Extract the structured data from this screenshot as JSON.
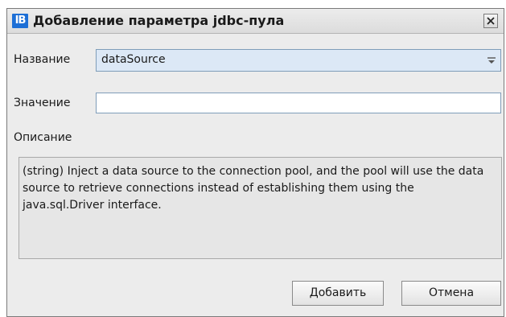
{
  "window": {
    "app_icon": "IB",
    "title": "Добавление параметра jdbc-пула",
    "close_icon": "close-icon"
  },
  "form": {
    "name_label": "Название",
    "name_value": "dataSource",
    "value_label": "Значение",
    "value_input": "",
    "description_label": "Описание",
    "description_text": "(string) Inject a data source to the connection pool, and the pool will use the data source to retrieve connections instead of establishing them using the java.sql.Driver interface."
  },
  "buttons": {
    "add_label": "Добавить",
    "cancel_label": "Отмена"
  },
  "colors": {
    "title_icon_bg": "#1d6fd6",
    "combo_bg": "#dce8f6",
    "dialog_bg": "#ececec"
  }
}
